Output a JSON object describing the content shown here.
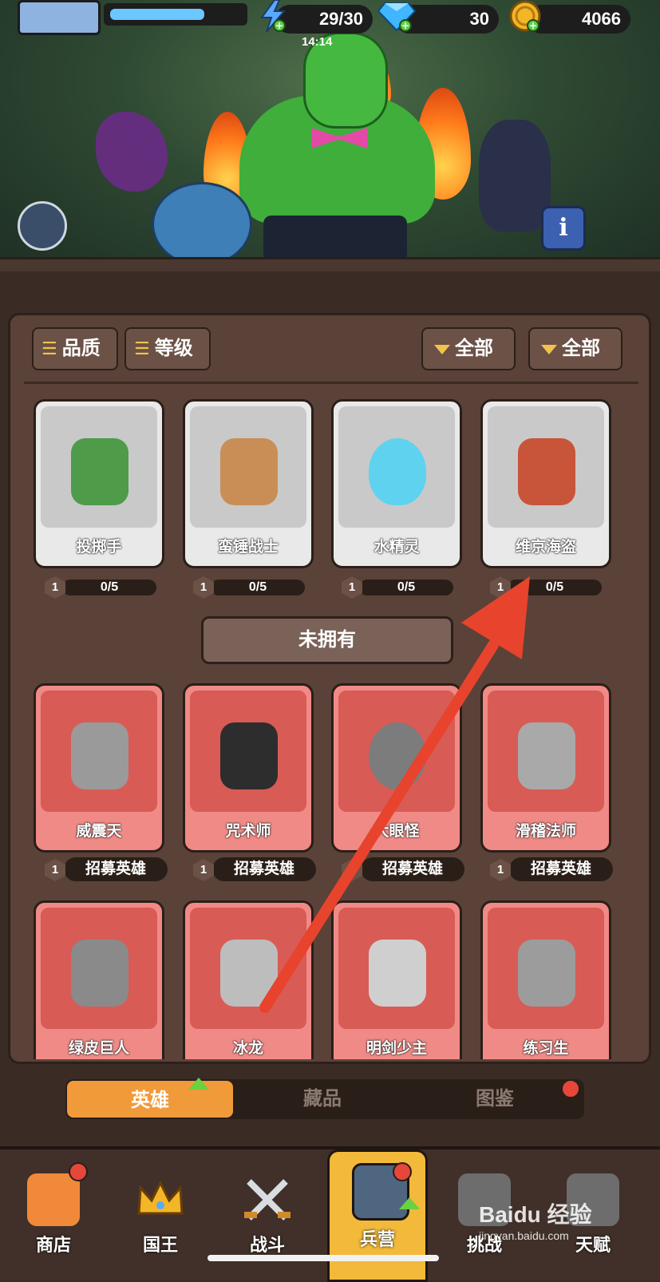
{
  "topbar": {
    "energy": "29/30",
    "energy_timer": "14:14",
    "gems": "30",
    "coins": "4066",
    "xp_progress": 0.72
  },
  "filters": {
    "quality": "品质",
    "level": "等级",
    "filter1": "全部",
    "filter2": "全部"
  },
  "owned_heroes": [
    {
      "name": "投掷手",
      "level": "1",
      "progress": "0/5"
    },
    {
      "name": "蛮锤战士",
      "level": "1",
      "progress": "0/5"
    },
    {
      "name": "水精灵",
      "level": "1",
      "progress": "0/5"
    },
    {
      "name": "维京海盗",
      "level": "1",
      "progress": "0/5"
    }
  ],
  "unowned_label": "未拥有",
  "unowned_heroes": [
    {
      "name": "威震天",
      "level": "1",
      "action": "招募英雄"
    },
    {
      "name": "咒术师",
      "level": "1",
      "action": "招募英雄"
    },
    {
      "name": "大眼怪",
      "level": "1",
      "action": "招募英雄"
    },
    {
      "name": "滑稽法师",
      "level": "1",
      "action": "招募英雄"
    },
    {
      "name": "绿皮巨人"
    },
    {
      "name": "冰龙"
    },
    {
      "name": "明剑少主"
    },
    {
      "name": "练习生"
    }
  ],
  "tabs": [
    "英雄",
    "藏品",
    "图鉴"
  ],
  "nav": [
    "商店",
    "国王",
    "战斗",
    "兵营",
    "挑战",
    "天赋"
  ],
  "watermark": {
    "brand": "Baidu 经验",
    "url": "jingyan.baidu.com"
  },
  "colors": {
    "accent": "#f09a3a",
    "locked_card": "#d85b56",
    "arrow": "#e8432c",
    "panel": "#5a4239"
  }
}
